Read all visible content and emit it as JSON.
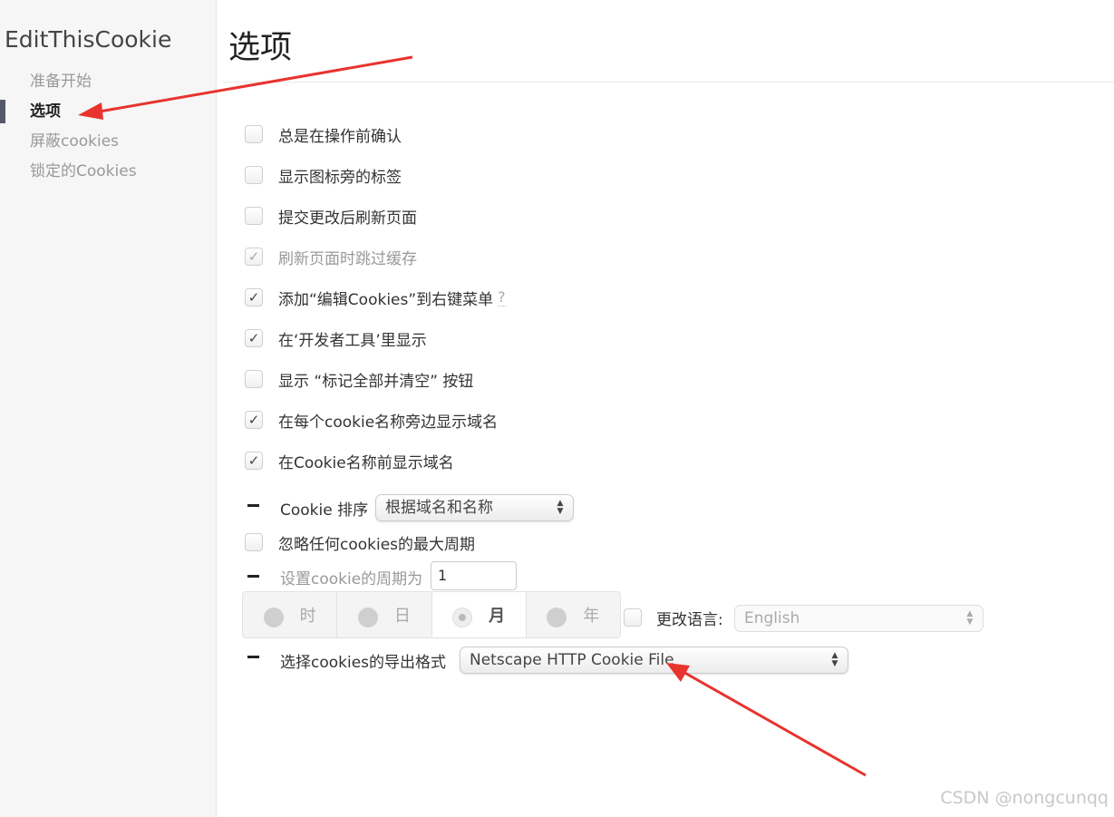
{
  "sidebar": {
    "app_title": "EditThisCookie",
    "items": [
      {
        "label": "准备开始",
        "active": false
      },
      {
        "label": "选项",
        "active": true
      },
      {
        "label": "屏蔽cookies",
        "active": false
      },
      {
        "label": "锁定的Cookies",
        "active": false
      }
    ]
  },
  "page_title": "选项",
  "options": [
    {
      "label": "总是在操作前确认",
      "checked": false
    },
    {
      "label": "显示图标旁的标签",
      "checked": false
    },
    {
      "label": "提交更改后刷新页面",
      "checked": false
    },
    {
      "label": "刷新页面时跳过缓存",
      "checked": true,
      "disabled": true
    },
    {
      "label": "添加“编辑Cookies”到右键菜单",
      "checked": true,
      "help": "?"
    },
    {
      "label": "在‘开发者工具’里显示",
      "checked": true
    },
    {
      "label": "显示 “标记全部并清空” 按钮",
      "checked": false
    },
    {
      "label": "在每个cookie名称旁边显示域名",
      "checked": true
    },
    {
      "label": "在Cookie名称前显示域名",
      "checked": true
    }
  ],
  "sort": {
    "label": "Cookie 排序",
    "selected": "根据域名和名称"
  },
  "ignore_max_age": {
    "label": "忽略任何cookies的最大周期",
    "checked": false
  },
  "max_age": {
    "label": "设置cookie的周期为",
    "value": "1",
    "units": [
      "时",
      "日",
      "月",
      "年"
    ],
    "selected_unit": "月"
  },
  "language": {
    "checkbox_label": "更改语言:",
    "checked": false,
    "selected": "English"
  },
  "export_format": {
    "label": "选择cookies的导出格式",
    "selected": "Netscape HTTP Cookie File"
  },
  "watermark": "CSDN @nongcunqq",
  "colors": {
    "sidebar_bg": "#f6f6f6",
    "active_marker": "#555b66",
    "annotation_arrow": "#e8332e"
  },
  "icons": {
    "check": "✓",
    "select_arrows": "up-down-arrows-icon",
    "dash": "minus-icon"
  }
}
